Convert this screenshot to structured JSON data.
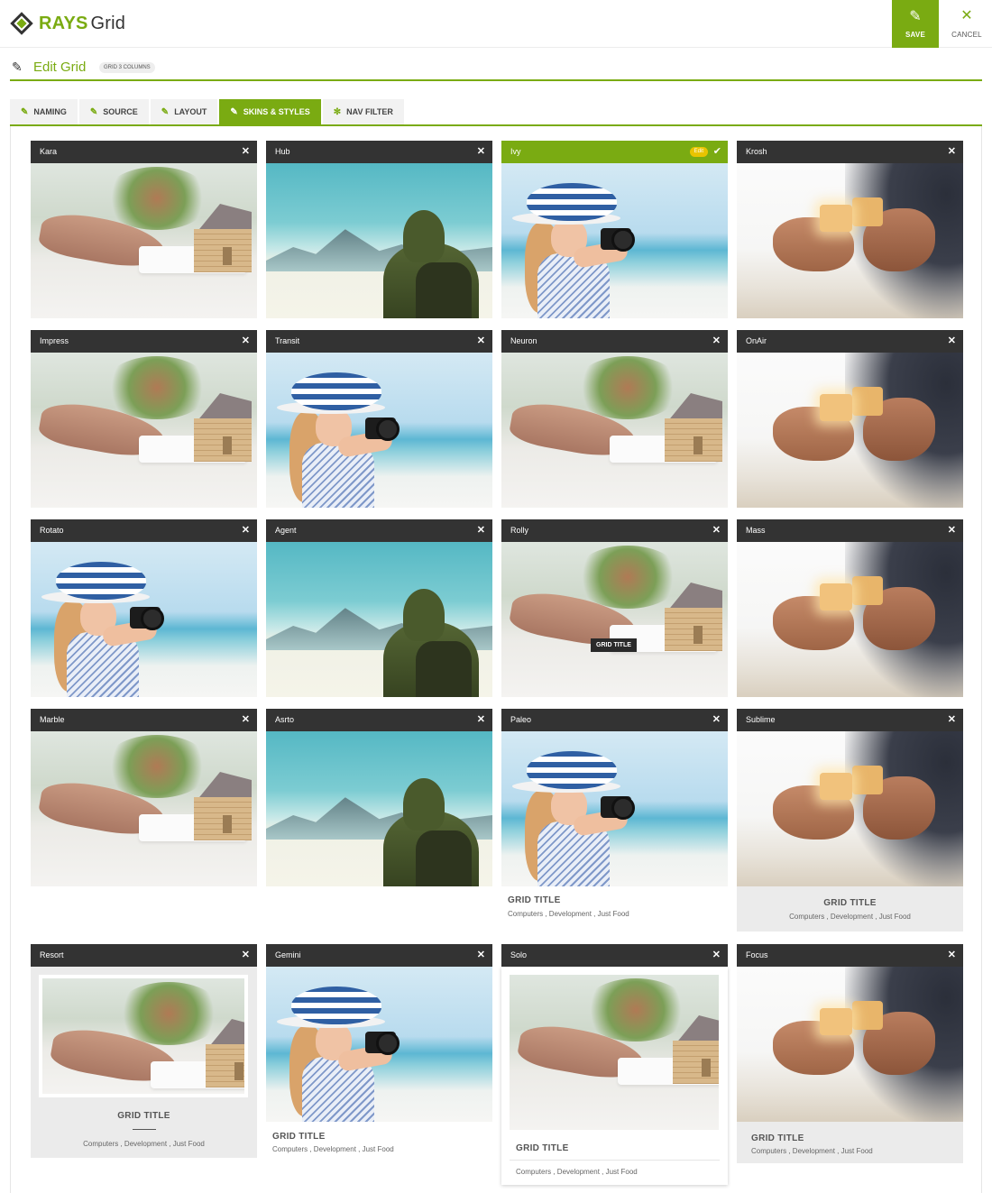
{
  "app": {
    "brand_bold": "RAYS",
    "brand_light": "Grid"
  },
  "toolbar": {
    "save_label": "SAVE",
    "cancel_label": "CANCEL"
  },
  "page": {
    "title": "Edit Grid",
    "badge": "GRID 3 COLUMNS"
  },
  "tabs": [
    {
      "label": "NAMING",
      "icon": "brush-icon",
      "active": false
    },
    {
      "label": "SOURCE",
      "icon": "wrench-icon",
      "active": false
    },
    {
      "label": "LAYOUT",
      "icon": "brush-icon",
      "active": false
    },
    {
      "label": "SKINS & STYLES",
      "icon": "brush-icon",
      "active": true
    },
    {
      "label": "NAV FILTER",
      "icon": "gear-icon",
      "active": false
    }
  ],
  "colors": {
    "accent": "#7aab12",
    "header_dark": "#333333",
    "edit_pill": "#e8c400"
  },
  "skins": [
    {
      "name": "Kara",
      "image": "house"
    },
    {
      "name": "Hub",
      "image": "snow"
    },
    {
      "name": "Ivy",
      "image": "girl",
      "active": true,
      "edit_label": "Edit"
    },
    {
      "name": "Krosh",
      "image": "puzzle"
    },
    {
      "name": "Impress",
      "image": "house"
    },
    {
      "name": "Transit",
      "image": "girl"
    },
    {
      "name": "Neuron",
      "image": "house"
    },
    {
      "name": "OnAir",
      "image": "puzzle"
    },
    {
      "name": "Rotato",
      "image": "girl"
    },
    {
      "name": "Agent",
      "image": "snow"
    },
    {
      "name": "Rolly",
      "image": "house",
      "overlay": "GRID TITLE"
    },
    {
      "name": "Mass",
      "image": "puzzle"
    },
    {
      "name": "Marble",
      "image": "house"
    },
    {
      "name": "Asrto",
      "image": "snow"
    },
    {
      "name": "Paleo",
      "image": "girl"
    },
    {
      "name": "Sublime",
      "image": "puzzle"
    },
    {
      "name": "Resort",
      "image": "house"
    },
    {
      "name": "Gemini",
      "image": "girl"
    },
    {
      "name": "Solo",
      "image": "house"
    },
    {
      "name": "Focus",
      "image": "puzzle"
    }
  ],
  "caption": {
    "title": "GRID TITLE",
    "categories": "Computers , Development , Just Food"
  }
}
